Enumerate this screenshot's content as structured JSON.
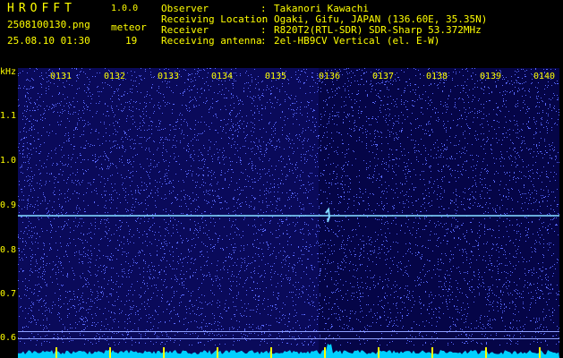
{
  "header": {
    "app_title": "HROFFT",
    "version": "1.0.0",
    "filename": "2508100130.png",
    "meteor_label": "meteor",
    "datetime": "25.08.10 01:30",
    "meteor_count": "19"
  },
  "info": [
    {
      "key": "Observer",
      "sep": ":",
      "value": "Takanori Kawachi"
    },
    {
      "key": "Receiving Location",
      "sep": ":",
      "value": "Ogaki, Gifu, JAPAN (136.60E, 35.35N)"
    },
    {
      "key": "Receiver",
      "sep": ":",
      "value": "R820T2(RTL-SDR) SDR-Sharp 53.372MHz"
    },
    {
      "key": "Receiving antenna",
      "sep": ":",
      "value": "2el-HB9CV Vertical (el. E-W)"
    }
  ],
  "axis": {
    "unit": "kHz",
    "y_ticks": [
      "1.1",
      "1.0",
      "0.9",
      "0.8",
      "0.7",
      "0.6"
    ],
    "x_ticks": [
      "0131",
      "0132",
      "0133",
      "0134",
      "0135",
      "0136",
      "0137",
      "0138",
      "0139",
      "0140"
    ]
  },
  "colors": {
    "label": "#ffff00",
    "background": "#0a0a5a",
    "noise": "#5a6aff",
    "carrier": "#7fd6ff",
    "spectrum": "#00d0ff"
  }
}
